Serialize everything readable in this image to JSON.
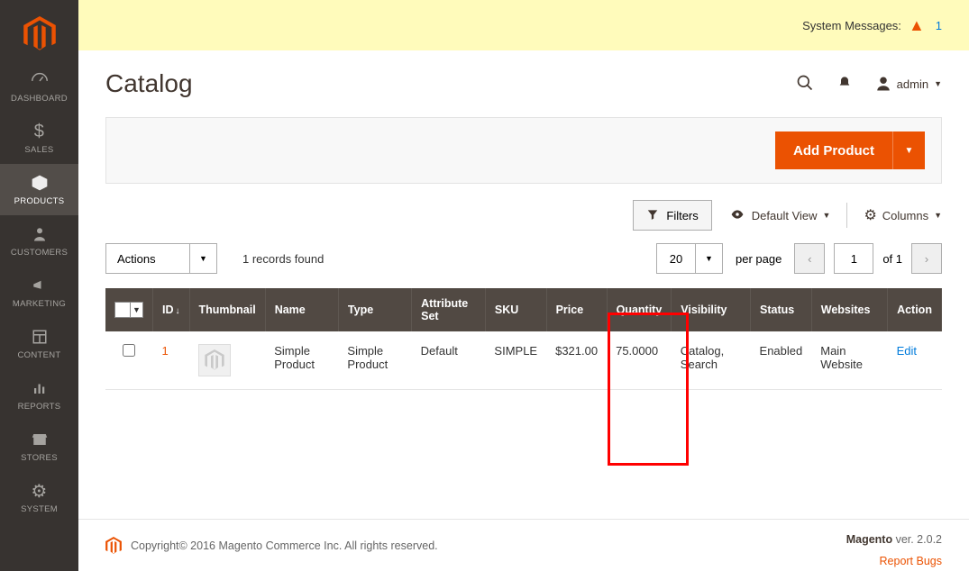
{
  "sidebar": {
    "items": [
      {
        "label": "DASHBOARD"
      },
      {
        "label": "SALES"
      },
      {
        "label": "PRODUCTS"
      },
      {
        "label": "CUSTOMERS"
      },
      {
        "label": "MARKETING"
      },
      {
        "label": "CONTENT"
      },
      {
        "label": "REPORTS"
      },
      {
        "label": "STORES"
      },
      {
        "label": "SYSTEM"
      }
    ]
  },
  "system_messages": {
    "label": "System Messages:",
    "count": "1"
  },
  "header": {
    "title": "Catalog",
    "user": "admin"
  },
  "actions": {
    "add_product": "Add Product"
  },
  "toolbar": {
    "filters": "Filters",
    "default_view": "Default View",
    "columns": "Columns"
  },
  "grid_controls": {
    "actions_label": "Actions",
    "records": "1 records found",
    "perpage_value": "20",
    "perpage_label": "per page",
    "page_value": "1",
    "of_label": "of 1"
  },
  "columns": {
    "id": "ID",
    "thumb": "Thumbnail",
    "name": "Name",
    "type": "Type",
    "attrset": "Attribute Set",
    "sku": "SKU",
    "price": "Price",
    "qty": "Quantity",
    "vis": "Visibility",
    "status": "Status",
    "web": "Websites",
    "action": "Action"
  },
  "rows": [
    {
      "id": "1",
      "name": "Simple Product",
      "type": "Simple Product",
      "attrset": "Default",
      "sku": "SIMPLE",
      "price": "$321.00",
      "qty": "75.0000",
      "vis": "Catalog, Search",
      "status": "Enabled",
      "web": "Main Website",
      "action": "Edit"
    }
  ],
  "footer": {
    "copyright": "Copyright© 2016 Magento Commerce Inc. All rights reserved.",
    "brand": "Magento",
    "ver": " ver. 2.0.2",
    "bugs": "Report Bugs"
  }
}
